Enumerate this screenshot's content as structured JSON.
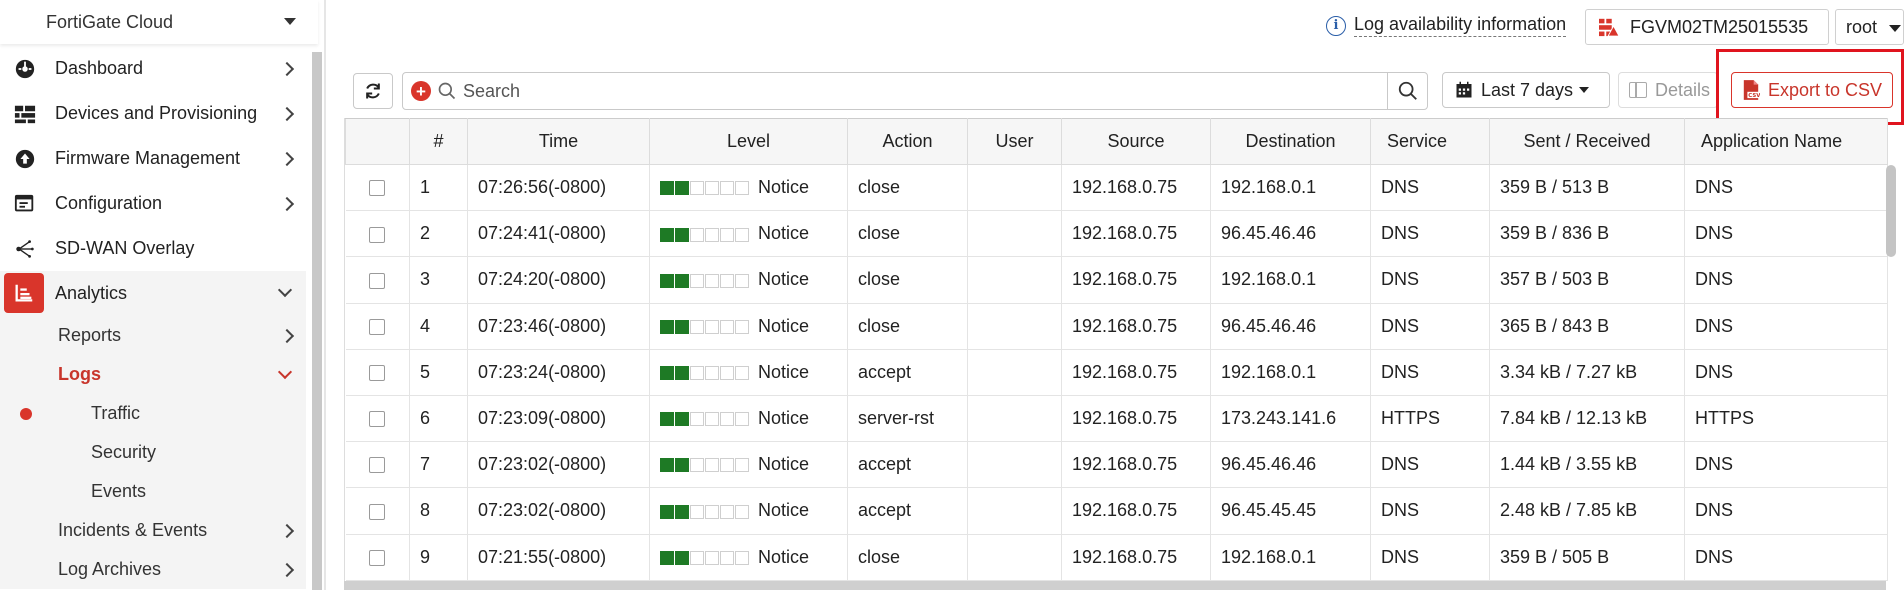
{
  "sidebar": {
    "tenant": "FortiGate Cloud",
    "items": [
      {
        "label": "Dashboard",
        "icon": "dashboard-icon"
      },
      {
        "label": "Devices and Provisioning",
        "icon": "devices-icon"
      },
      {
        "label": "Firmware Management",
        "icon": "upload-icon"
      },
      {
        "label": "Configuration",
        "icon": "config-icon"
      },
      {
        "label": "SD-WAN Overlay",
        "icon": "sdwan-icon"
      },
      {
        "label": "Analytics",
        "icon": "analytics-icon"
      }
    ],
    "analytics_sub": [
      {
        "label": "Reports"
      },
      {
        "label": "Logs"
      }
    ],
    "logs_sub": [
      {
        "label": "Traffic"
      },
      {
        "label": "Security"
      },
      {
        "label": "Events"
      }
    ],
    "analytics_sub2": [
      {
        "label": "Incidents & Events"
      },
      {
        "label": "Log Archives"
      }
    ]
  },
  "topbar": {
    "info_label": "Log availability information",
    "info_icon": "i",
    "device": "FGVM02TM25015535",
    "vdom": "root"
  },
  "toolbar": {
    "search_placeholder": "Search",
    "date_range": "Last 7 days",
    "details_label": "Details",
    "export_label": "Export to CSV"
  },
  "colors": {
    "accent_red": "#d9352b",
    "level_green": "#1e7a25",
    "highlight_red": "#e0141e"
  },
  "table": {
    "columns": [
      "#",
      "Time",
      "Level",
      "Action",
      "User",
      "Source",
      "Destination",
      "Service",
      "Sent / Received",
      "Application Name"
    ],
    "rows": [
      {
        "num": "1",
        "time": "07:26:56(-0800)",
        "level": "Notice",
        "level_value": 2,
        "action": "close",
        "user": "",
        "source": "192.168.0.75",
        "destination": "192.168.0.1",
        "service": "DNS",
        "sent_received": "359 B / 513 B",
        "app": "DNS"
      },
      {
        "num": "2",
        "time": "07:24:41(-0800)",
        "level": "Notice",
        "level_value": 2,
        "action": "close",
        "user": "",
        "source": "192.168.0.75",
        "destination": "96.45.46.46",
        "service": "DNS",
        "sent_received": "359 B / 836 B",
        "app": "DNS"
      },
      {
        "num": "3",
        "time": "07:24:20(-0800)",
        "level": "Notice",
        "level_value": 2,
        "action": "close",
        "user": "",
        "source": "192.168.0.75",
        "destination": "192.168.0.1",
        "service": "DNS",
        "sent_received": "357 B / 503 B",
        "app": "DNS"
      },
      {
        "num": "4",
        "time": "07:23:46(-0800)",
        "level": "Notice",
        "level_value": 2,
        "action": "close",
        "user": "",
        "source": "192.168.0.75",
        "destination": "96.45.46.46",
        "service": "DNS",
        "sent_received": "365 B / 843 B",
        "app": "DNS"
      },
      {
        "num": "5",
        "time": "07:23:24(-0800)",
        "level": "Notice",
        "level_value": 2,
        "action": "accept",
        "user": "",
        "source": "192.168.0.75",
        "destination": "192.168.0.1",
        "service": "DNS",
        "sent_received": "3.34 kB / 7.27 kB",
        "app": "DNS"
      },
      {
        "num": "6",
        "time": "07:23:09(-0800)",
        "level": "Notice",
        "level_value": 2,
        "action": "server-rst",
        "user": "",
        "source": "192.168.0.75",
        "destination": "173.243.141.6",
        "service": "HTTPS",
        "sent_received": "7.84 kB / 12.13 kB",
        "app": "HTTPS"
      },
      {
        "num": "7",
        "time": "07:23:02(-0800)",
        "level": "Notice",
        "level_value": 2,
        "action": "accept",
        "user": "",
        "source": "192.168.0.75",
        "destination": "96.45.46.46",
        "service": "DNS",
        "sent_received": "1.44 kB / 3.55 kB",
        "app": "DNS"
      },
      {
        "num": "8",
        "time": "07:23:02(-0800)",
        "level": "Notice",
        "level_value": 2,
        "action": "accept",
        "user": "",
        "source": "192.168.0.75",
        "destination": "96.45.45.45",
        "service": "DNS",
        "sent_received": "2.48 kB / 7.85 kB",
        "app": "DNS"
      },
      {
        "num": "9",
        "time": "07:21:55(-0800)",
        "level": "Notice",
        "level_value": 2,
        "action": "close",
        "user": "",
        "source": "192.168.0.75",
        "destination": "192.168.0.1",
        "service": "DNS",
        "sent_received": "359 B / 505 B",
        "app": "DNS"
      }
    ]
  }
}
